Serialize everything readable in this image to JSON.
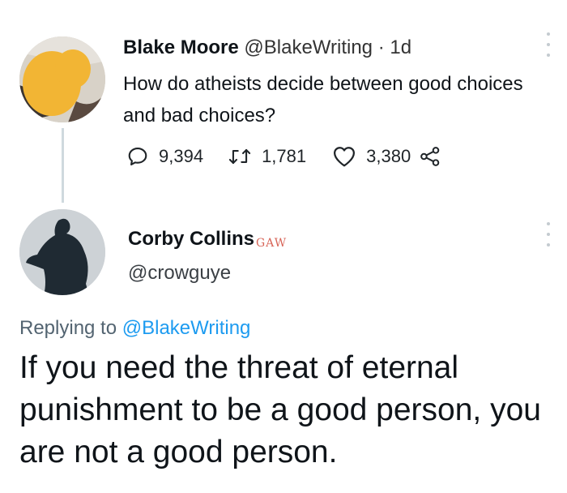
{
  "tweet": {
    "author_name": "Blake Moore",
    "author_handle": "@BlakeWriting",
    "separator": " · ",
    "time": "1d",
    "text": "How do atheists decide between good choices and bad choices?",
    "stats": {
      "replies": "9,394",
      "retweets": "1,781",
      "likes": "3,380"
    }
  },
  "reply": {
    "author_name": "Corby Collins",
    "author_handle": "@crowguye",
    "watermark": "GAW",
    "replying_prefix": "Replying to ",
    "replying_to": "@BlakeWriting",
    "text": "If you need the threat of eternal punishment to be a good person, you are not a good person."
  },
  "colors": {
    "accent": "#1d9bf0",
    "avatar_blur": "#f2b534",
    "thread_line": "#cfd9de",
    "watermark": "#d14b3b"
  },
  "icons": [
    "reply-icon",
    "retweet-icon",
    "like-icon",
    "share-icon",
    "more-icon"
  ]
}
